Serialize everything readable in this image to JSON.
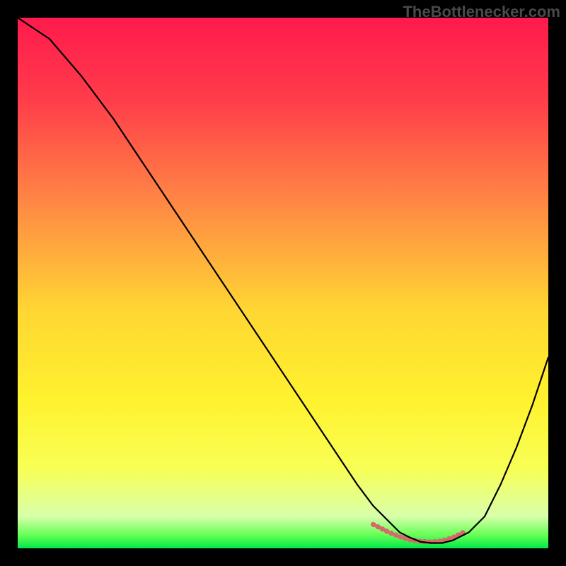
{
  "watermark": "TheBottlenecker.com",
  "chart_data": {
    "type": "line",
    "title": "",
    "xlabel": "",
    "ylabel": "",
    "xlim": [
      0,
      100
    ],
    "ylim": [
      0,
      100
    ],
    "background_gradient": {
      "stops": [
        {
          "offset": 0.0,
          "color": "#ff1a4d"
        },
        {
          "offset": 0.15,
          "color": "#ff3b4a"
        },
        {
          "offset": 0.35,
          "color": "#ff8844"
        },
        {
          "offset": 0.55,
          "color": "#ffd633"
        },
        {
          "offset": 0.72,
          "color": "#fff22e"
        },
        {
          "offset": 0.85,
          "color": "#f8ff55"
        },
        {
          "offset": 0.94,
          "color": "#d8ffaa"
        },
        {
          "offset": 0.975,
          "color": "#66ff55"
        },
        {
          "offset": 1.0,
          "color": "#00e84a"
        }
      ]
    },
    "series": [
      {
        "name": "bottleneck-curve",
        "color": "#000000",
        "width": 2.2,
        "x": [
          0,
          6,
          12,
          18,
          24,
          30,
          36,
          42,
          48,
          54,
          60,
          64,
          67,
          70,
          72,
          74,
          76,
          78,
          80,
          82,
          85,
          88,
          91,
          94,
          97,
          100
        ],
        "y": [
          100,
          96,
          89,
          81,
          72,
          63,
          54,
          45,
          36,
          27,
          18,
          12,
          8,
          5,
          3,
          2,
          1.2,
          1,
          1,
          1.5,
          3,
          6,
          12,
          19,
          27,
          36
        ]
      },
      {
        "name": "highlight-band",
        "color": "#d46a6a",
        "width": 7,
        "x": [
          67,
          70,
          72,
          74,
          76,
          78,
          80,
          82,
          84
        ],
        "y": [
          4.5,
          3.0,
          2.2,
          1.6,
          1.3,
          1.2,
          1.4,
          2.0,
          3.0
        ]
      }
    ]
  }
}
